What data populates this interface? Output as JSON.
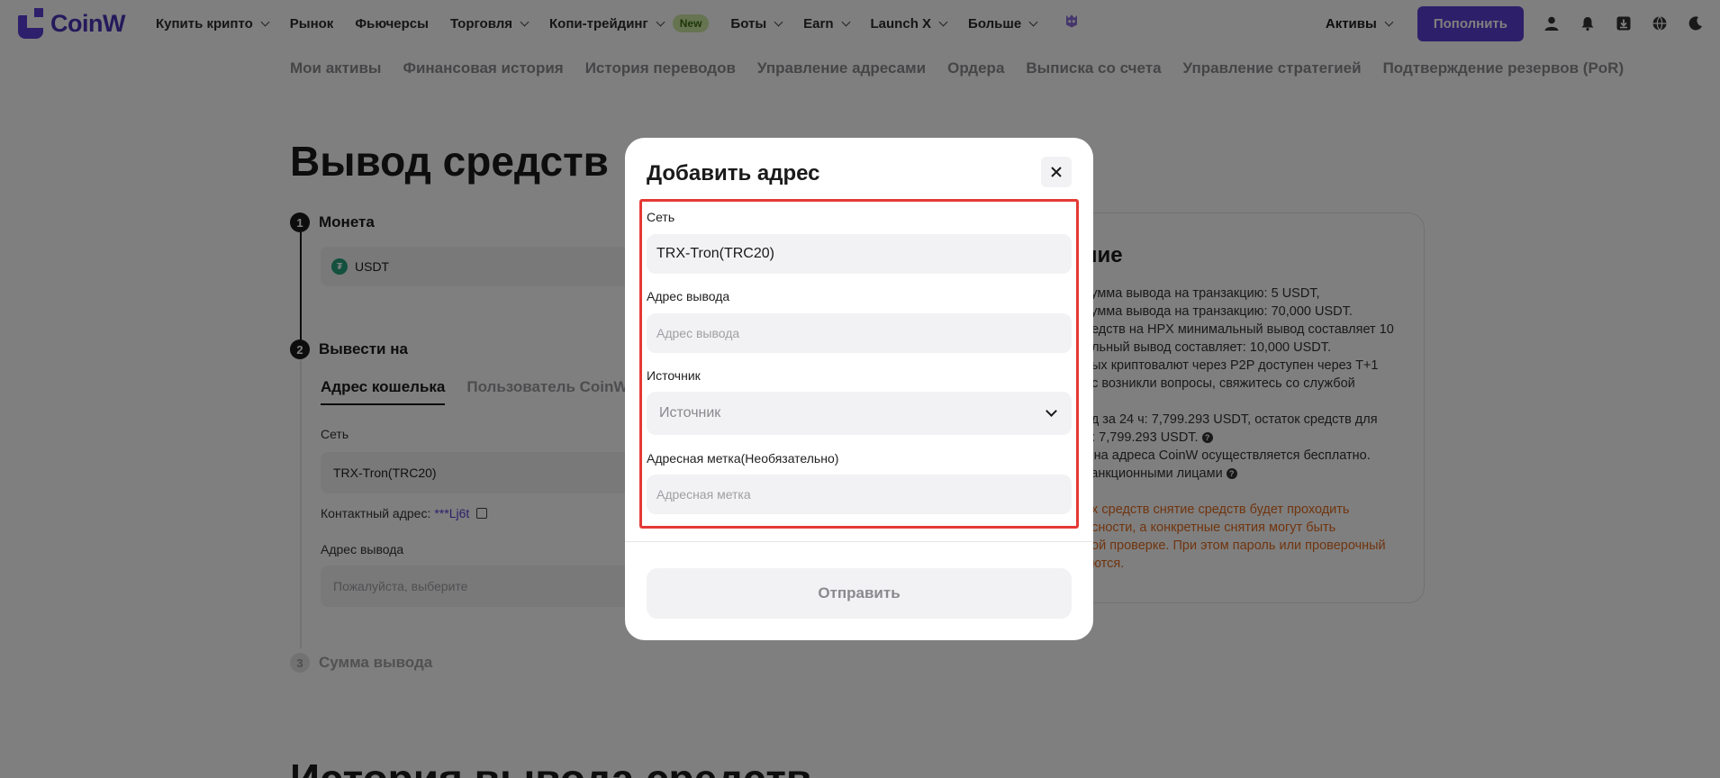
{
  "brand": {
    "name": "CoinW",
    "accent": "#5a3fd4"
  },
  "nav": {
    "items": [
      {
        "label": "Купить крипто",
        "dropdown": true
      },
      {
        "label": "Рынок",
        "dropdown": false
      },
      {
        "label": "Фьючерсы",
        "dropdown": false
      },
      {
        "label": "Торговля",
        "dropdown": true
      },
      {
        "label": "Копи-трейдинг",
        "dropdown": true,
        "badge": "New"
      },
      {
        "label": "Боты",
        "dropdown": true
      },
      {
        "label": "Earn",
        "dropdown": true
      },
      {
        "label": "Launch X",
        "dropdown": true
      },
      {
        "label": "Больше",
        "dropdown": true
      }
    ],
    "assets_label": "Активы",
    "deposit_label": "Пополнить"
  },
  "subnav": [
    "Мои активы",
    "Финансовая история",
    "История переводов",
    "Управление адресами",
    "Ордера",
    "Выписка со счета",
    "Управление стратегией",
    "Подтверждение резервов (PoR)"
  ],
  "page": {
    "title": "Вывод средств",
    "step1": {
      "num": "1",
      "label": "Монета",
      "coin": "USDT"
    },
    "step2": {
      "num": "2",
      "label": "Вывести на",
      "tabs": [
        "Адрес кошелька",
        "Пользователь CoinW"
      ],
      "network_label": "Сеть",
      "network_value": "TRX-Tron(TRC20)",
      "contact_label": "Контактный адрес:",
      "contact_value": "***Lj6t",
      "address_label": "Адрес вывода",
      "address_placeholder": "Пожалуйста, выберите"
    },
    "step3": {
      "num": "3",
      "label": "Сумма вывода"
    },
    "history_title": "История вывода средств"
  },
  "info": {
    "title": "ние",
    "lines": [
      "сумма вывода на транзакцию: 5 USDT,",
      "сумма вывода на транзакцию: 70,000 USDT.",
      "редств на HPX минимальный вывод составляет 10",
      "альный вывод составляет: 10,000 USDT.",
      "ных криптовалют через P2P доступен через T+1",
      "ас возникли вопросы, свяжитесь со службой"
    ],
    "lines2": [
      "од за 24 ч: 7,799.293 USDT, остаток средств для",
      "и: 7,799.293 USDT.",
      "з на адреса CoinW осуществляется бесплатно.",
      "санкционными лицами"
    ],
    "warn_lines": [
      "их средств снятие средств будет проходить",
      "асности, а конкретные снятия могут быть",
      "ной проверке. При этом пароль или проверочный",
      "аются."
    ],
    "warn_color": "#e06a1f"
  },
  "modal": {
    "title": "Добавить адрес",
    "network_label": "Сеть",
    "network_value": "TRX-Tron(TRC20)",
    "address_label": "Адрес вывода",
    "address_placeholder": "Адрес вывода",
    "source_label": "Источник",
    "source_placeholder": "Источник",
    "tag_label": "Адресная метка(Необязательно)",
    "tag_placeholder": "Адресная метка",
    "submit_label": "Отправить",
    "highlight_color": "#e53935"
  }
}
